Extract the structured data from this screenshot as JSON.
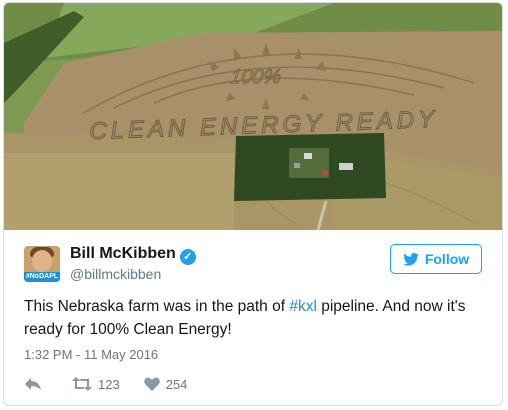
{
  "photo": {
    "crop_text_main": "CLEAN ENERGY READY",
    "crop_text_percent": "100%"
  },
  "tweet": {
    "avatar_tag": "#NoDAPL",
    "name": "Bill McKibben",
    "verified_icon": "verified-badge-icon",
    "handle": "@billmckibben",
    "follow_label": "Follow",
    "text_before": "This Nebraska farm was in the path of ",
    "hashtag": "#kxl",
    "text_after": " pipeline. And now it's ready for 100% Clean Energy!",
    "timestamp": "1:32 PM - 11 May 2016",
    "retweet_count": "123",
    "like_count": "254"
  },
  "colors": {
    "accent": "#1da1f2",
    "link": "#1b95e0",
    "text": "#14171a",
    "muted": "#657786"
  }
}
